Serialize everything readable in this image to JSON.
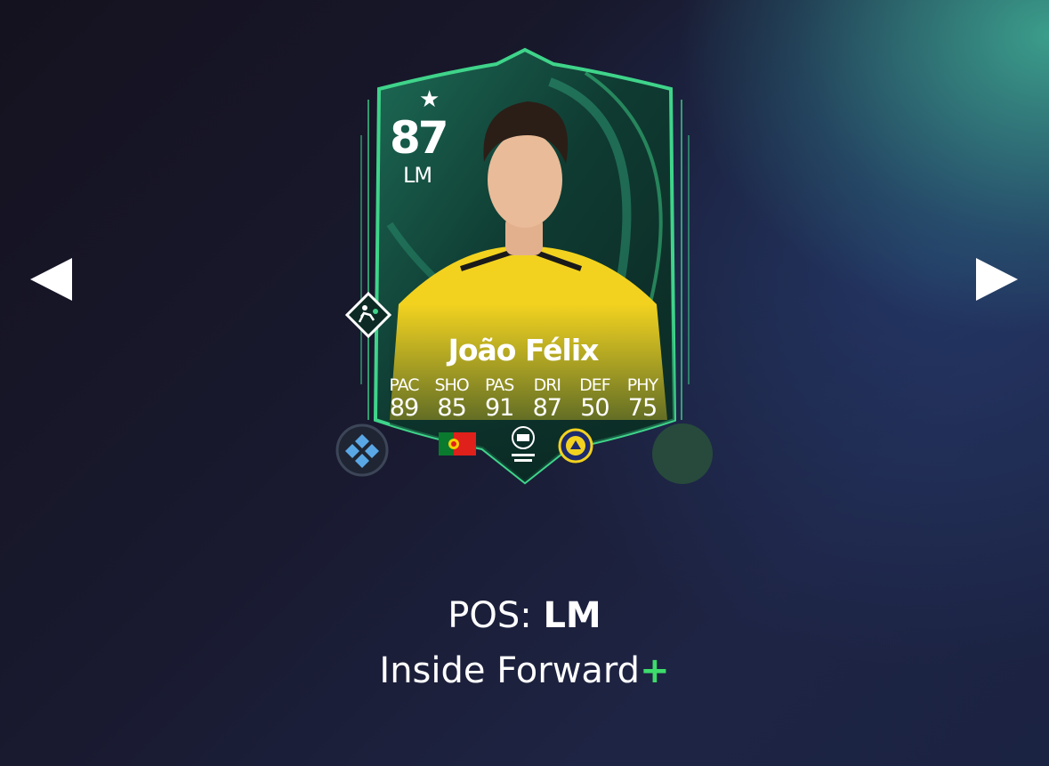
{
  "nav": {
    "prev_label": "◀",
    "next_label": "▶"
  },
  "card": {
    "rating": "87",
    "position": "LM",
    "star": "★",
    "name": "João Félix",
    "stats": [
      {
        "label": "PAC",
        "value": "89"
      },
      {
        "label": "SHO",
        "value": "85"
      },
      {
        "label": "PAS",
        "value": "91"
      },
      {
        "label": "DRI",
        "value": "87"
      },
      {
        "label": "DEF",
        "value": "50"
      },
      {
        "label": "PHY",
        "value": "75"
      }
    ],
    "nation_icon": "portugal-flag-icon",
    "league_icon": "roshn-saudi-league-icon",
    "club_icon": "al-nassr-crest-icon",
    "chemistry_style_icon": "player-role-icon",
    "colors": {
      "frame": "#3fd48a",
      "card_bg": "#0f3b32",
      "jersey": "#f2d21f"
    }
  },
  "info": {
    "pos_prefix": "POS: ",
    "pos_value": "LM",
    "role": "Inside Forward",
    "role_plus": "+",
    "plus_color": "#3ddc6b"
  }
}
